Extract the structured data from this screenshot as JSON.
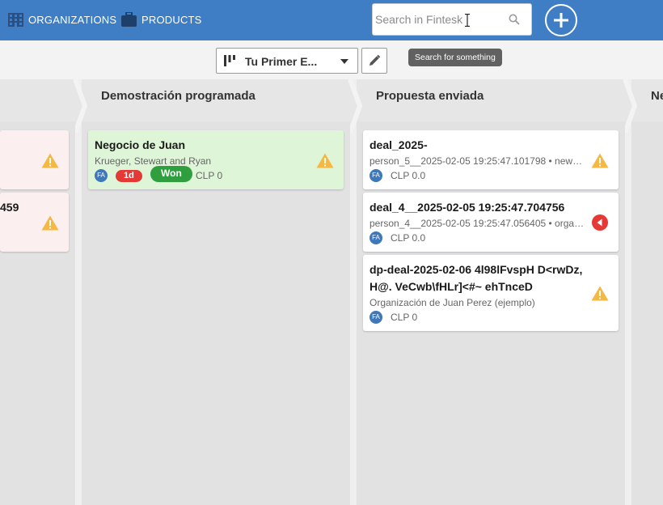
{
  "header": {
    "nav": [
      {
        "label": "ORGANIZATIONS",
        "icon": "building-icon"
      },
      {
        "label": "PRODUCTS",
        "icon": "briefcase-icon"
      }
    ],
    "search": {
      "placeholder": "Search in Fintesk",
      "tooltip": "Search for something"
    },
    "add_icon": "plus-circle-icon"
  },
  "toolbar": {
    "pipeline": "Tu Primer E...",
    "pipeline_icon": "kanban-icon",
    "edit_icon": "pencil-icon"
  },
  "board": {
    "columns": [
      {
        "title": "",
        "cards": [
          {
            "title": "",
            "status_icon": "warning-icon"
          },
          {
            "title": "459",
            "status_icon": "warning-icon"
          }
        ]
      },
      {
        "title": "Demostración programada",
        "cards": [
          {
            "title": "Negocio de Juan",
            "subtitle": "Krueger, Stewart and Ryan",
            "avatar": "FA",
            "days_badge": "1d",
            "status_badge": "Won",
            "amount": "CLP 0",
            "status_icon": "warning-icon"
          }
        ]
      },
      {
        "title": "Propuesta enviada",
        "cards": [
          {
            "title": "deal_2025-",
            "subtitle": "person_5__2025-02-05 19:25:47.101798 • new…",
            "avatar": "FA",
            "amount": "CLP 0.0",
            "status_icon": "warning-icon"
          },
          {
            "title": "deal_4__2025-02-05 19:25:47.704756",
            "subtitle": "person_4__2025-02-05 19:25:47.056405 • orga…",
            "avatar": "FA",
            "amount": "CLP 0.0",
            "status_icon": "overdue-icon"
          },
          {
            "title_line1": "dp-deal-2025-02-06 4l98lFvspH D<rwDz,",
            "title_line2": "H@. VeCwb\\fHLr]<#~ ehTnceD",
            "subtitle": "Organización de Juan Perez (ejemplo)",
            "avatar": "FA",
            "amount": "CLP 0",
            "status_icon": "warning-icon"
          }
        ]
      },
      {
        "title": "Ne"
      }
    ]
  },
  "colors": {
    "header": "#3f7ec4",
    "warning": "#f5b843",
    "danger": "#e53935",
    "won": "#2e9e3f",
    "avatar": "#3e78b8"
  }
}
